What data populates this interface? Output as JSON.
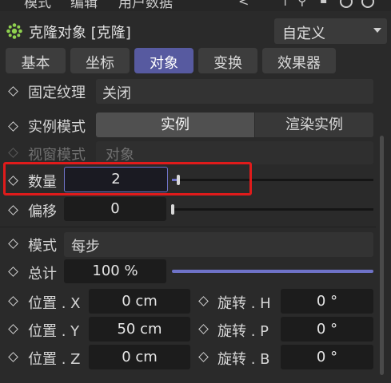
{
  "menu": {
    "items": [
      "模式",
      "编辑",
      "用户数据"
    ]
  },
  "header": {
    "title": "克隆对象 [克隆]",
    "preset": "自定义"
  },
  "tabs": [
    {
      "label": "基本",
      "active": false
    },
    {
      "label": "坐标",
      "active": false
    },
    {
      "label": "对象",
      "active": true
    },
    {
      "label": "变换",
      "active": false
    },
    {
      "label": "效果器",
      "active": false
    }
  ],
  "props": {
    "fixed_texture": {
      "label": "固定纹理",
      "value": "关闭"
    },
    "instance_mode": {
      "label": "实例模式",
      "options": [
        "实例",
        "渲染实例"
      ],
      "selected": "实例"
    },
    "viewport_mode": {
      "label": "视窗模式",
      "value": "对象"
    },
    "count": {
      "label": "数量",
      "value": "2"
    },
    "offset": {
      "label": "偏移",
      "value": "0"
    },
    "mode": {
      "label": "模式",
      "value": "每步"
    },
    "total": {
      "label": "总计",
      "value": "100 %"
    },
    "pos_x": {
      "label": "位置 . X",
      "value": "0 cm"
    },
    "pos_y": {
      "label": "位置 . Y",
      "value": "50 cm"
    },
    "pos_z": {
      "label": "位置 . Z",
      "value": "0 cm"
    },
    "rot_h": {
      "label": "旋转 . H",
      "value": "0 °"
    },
    "rot_p": {
      "label": "旋转 . P",
      "value": "0 °"
    },
    "rot_b": {
      "label": "旋转 . B",
      "value": "0 °"
    }
  },
  "colors": {
    "accent": "#575aa0",
    "highlight": "#e01b1b"
  }
}
